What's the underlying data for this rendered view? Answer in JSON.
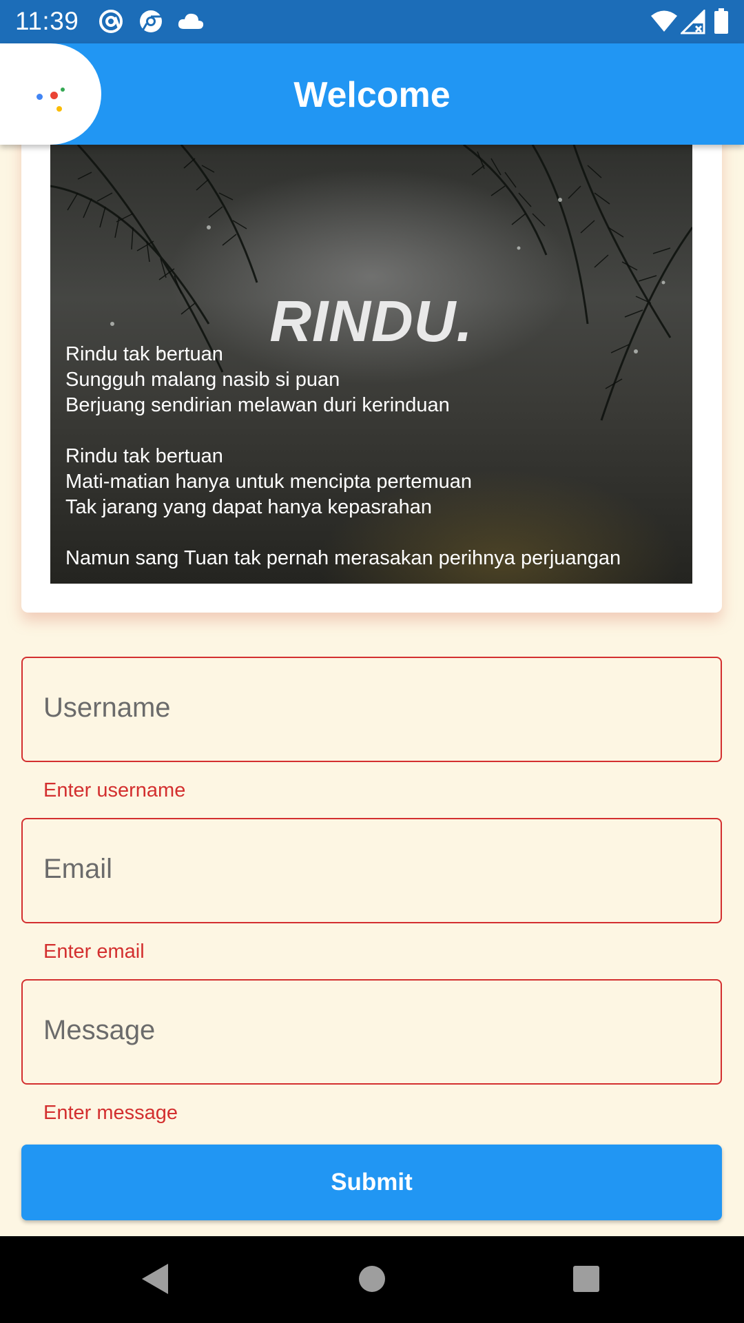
{
  "status_bar": {
    "time": "11:39",
    "icons_left": [
      "at-sign-icon",
      "chrome-icon",
      "cloud-icon"
    ],
    "icons_right": [
      "wifi-icon",
      "signal-icon",
      "battery-icon"
    ]
  },
  "app_bar": {
    "title": "Welcome",
    "color": "#2196F3",
    "assistant_dot_colors": [
      "#4285F4",
      "#EA4335",
      "#FBBC05",
      "#34A853"
    ]
  },
  "card": {
    "image_title": "RINDU.",
    "poem_stanzas": [
      [
        "Rindu tak bertuan",
        "Sungguh malang nasib si puan",
        "Berjuang sendirian melawan duri kerinduan"
      ],
      [
        "Rindu tak bertuan",
        "Mati-matian hanya untuk mencipta pertemuan",
        "Tak jarang yang dapat hanya kepasrahan"
      ],
      [
        "Namun sang Tuan tak pernah merasakan perihnya perjuangan"
      ]
    ]
  },
  "form": {
    "fields": [
      {
        "label": "Username",
        "error": "Enter username"
      },
      {
        "label": "Email",
        "error": "Enter email"
      },
      {
        "label": "Message",
        "error": "Enter message"
      }
    ],
    "error_color": "#D32F2F",
    "submit_label": "Submit"
  },
  "nav_bar": {
    "buttons": [
      "back-icon",
      "home-icon",
      "recents-icon"
    ]
  }
}
